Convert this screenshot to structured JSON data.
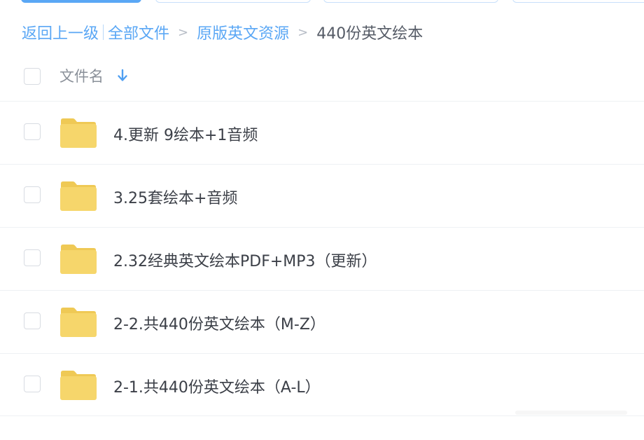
{
  "breadcrumb": {
    "back": "返回上一级",
    "all_files": "全部文件",
    "level1": "原版英文资源",
    "current": "440份英文绘本",
    "separator": ">"
  },
  "header": {
    "column_name": "文件名",
    "sort_icon": "arrow-down-icon"
  },
  "files": [
    {
      "name": "4.更新 9绘本+1音频",
      "icon": "folder-icon"
    },
    {
      "name": "3.25套绘本+音频",
      "icon": "folder-icon"
    },
    {
      "name": "2.32经典英文绘本PDF+MP3（更新）",
      "icon": "folder-icon"
    },
    {
      "name": "2-2.共440份英文绘本（M-Z）",
      "icon": "folder-icon"
    },
    {
      "name": "2-1.共440份英文绘本（A-L）",
      "icon": "folder-icon"
    }
  ],
  "colors": {
    "accent": "#5aa7f5",
    "folder": "#f6d66b",
    "folder_tab": "#efc955",
    "text": "#3b3f47",
    "muted": "#8a9099"
  }
}
